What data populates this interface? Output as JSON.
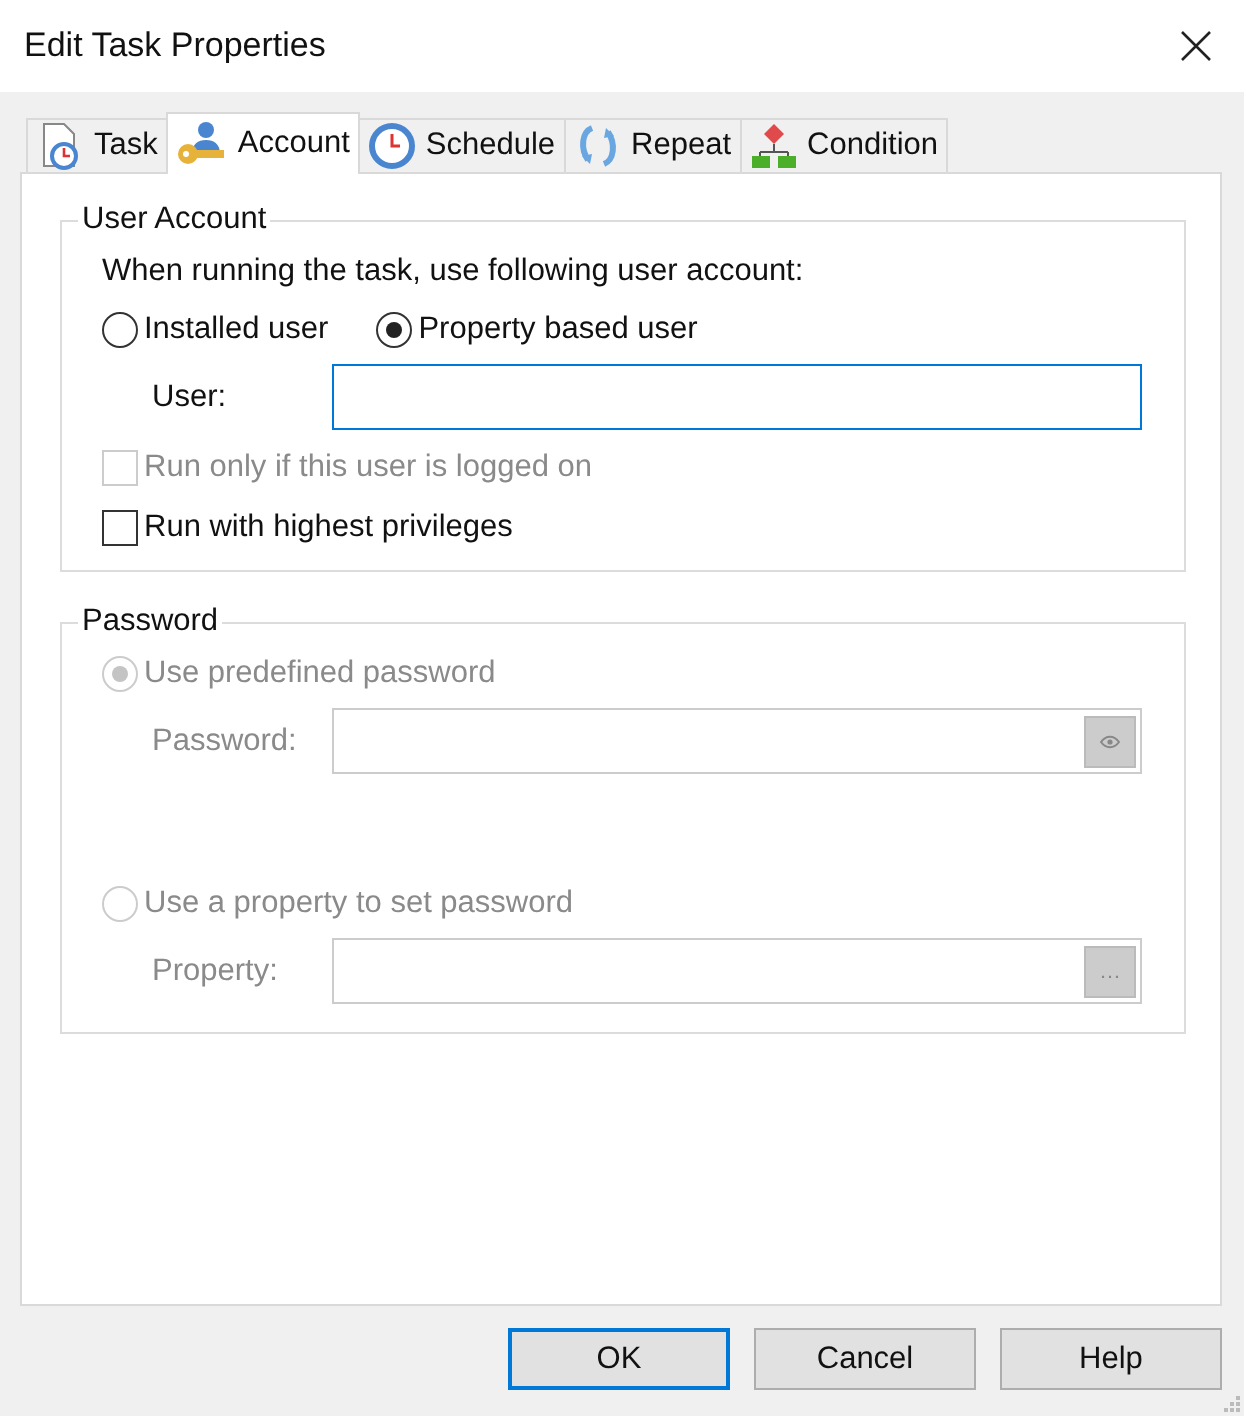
{
  "window": {
    "title": "Edit Task Properties"
  },
  "tabs": [
    {
      "label": "Task",
      "kind": "task",
      "selected": false
    },
    {
      "label": "Account",
      "kind": "account",
      "selected": true
    },
    {
      "label": "Schedule",
      "kind": "schedule",
      "selected": false
    },
    {
      "label": "Repeat",
      "kind": "repeat",
      "selected": false
    },
    {
      "label": "Condition",
      "kind": "condition",
      "selected": false
    }
  ],
  "user_account": {
    "title": "User Account",
    "prompt": "When running the task, use following user account:",
    "radios": [
      {
        "label": "Installed user",
        "selected": false,
        "disabled": false
      },
      {
        "label": "Property based user",
        "selected": true,
        "disabled": false
      }
    ],
    "user_field": {
      "label": "User:",
      "disabled": false
    },
    "checkboxes": [
      {
        "label": "Run only if this user is logged on",
        "checked": false,
        "disabled": true
      },
      {
        "label": "Run with highest privileges",
        "checked": false,
        "disabled": false
      }
    ]
  },
  "password": {
    "title": "Password",
    "options": [
      {
        "label": "Use predefined password",
        "selected": true,
        "disabled": true,
        "field_label": "Password:",
        "field_button": {
          "kind": "eye"
        }
      },
      {
        "label": "Use a property to set password",
        "selected": false,
        "disabled": true,
        "field_label": "Property:",
        "field_button": {
          "kind": "browse",
          "text": "…"
        }
      }
    ]
  },
  "buttons": [
    {
      "label": "OK",
      "default": true
    },
    {
      "label": "Cancel",
      "default": false
    },
    {
      "label": "Help",
      "default": false
    }
  ]
}
